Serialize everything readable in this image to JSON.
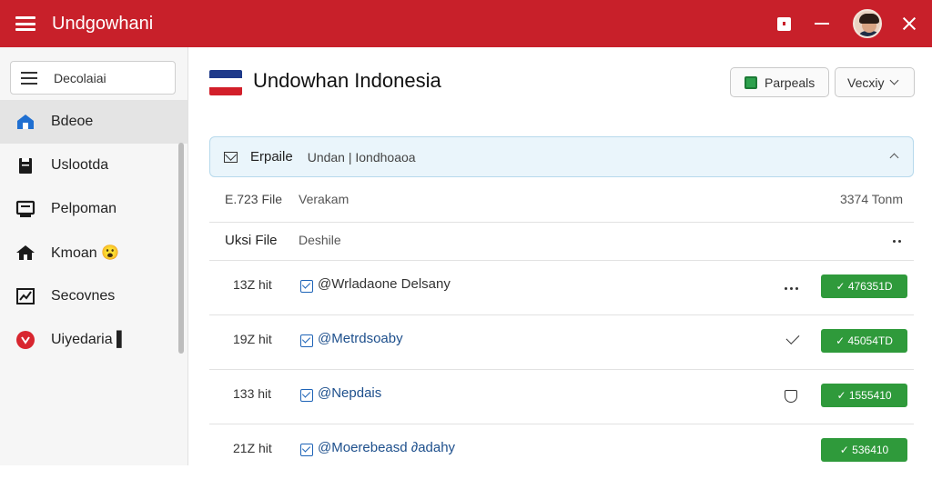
{
  "app": {
    "title": "Undgowhani"
  },
  "topbar": {
    "icons": [
      "menu-icon",
      "window-icon",
      "minimize-icon",
      "avatar",
      "close-icon"
    ]
  },
  "sidebar": {
    "search_label": "Decolaiai",
    "items": [
      {
        "label": "Bdeoe",
        "icon": "home-icon",
        "active": true
      },
      {
        "label": "Uslootda",
        "icon": "folder-icon",
        "active": false
      },
      {
        "label": "Pelpoman",
        "icon": "monitor-icon",
        "active": false
      },
      {
        "label": "Kmoan 😮",
        "icon": "house-icon",
        "active": false
      },
      {
        "label": "Secovnes",
        "icon": "chart-icon",
        "active": false
      },
      {
        "label": "Uiyedaria ▌",
        "icon": "record-icon",
        "active": false
      }
    ]
  },
  "header": {
    "title": "Undowhan Indonesia",
    "share_label": "Parpeals",
    "view_label": "Vecxiy"
  },
  "filter": {
    "label": "Erpaile",
    "value": "Undan | Iondhoaoa"
  },
  "summary": {
    "count": "E.723 File",
    "col2": "Verakam",
    "col3": "3374 Tonm"
  },
  "table": {
    "col_file": "Uksi File",
    "col_desc": "Deshile",
    "rows": [
      {
        "size": "13Z hit",
        "name": "@Wrladaone Delsany",
        "action_icon": "more-icon",
        "badge": "✓ 476351D"
      },
      {
        "size": "19Z hit",
        "name": "@Metrdsoaby",
        "action_icon": "check-icon",
        "badge": "✓ 45054TD"
      },
      {
        "size": "133 hit",
        "name": "@Nepdais",
        "action_icon": "shield-icon",
        "badge": "✓ 1555410"
      },
      {
        "size": "21Z hit",
        "name": "@Moerebeasd ∂adahy",
        "action_icon": "",
        "badge": "✓ 536410"
      }
    ]
  },
  "colors": {
    "topbar": "#c8202a",
    "badge": "#2f9a3b",
    "link": "#1d4f8c"
  }
}
